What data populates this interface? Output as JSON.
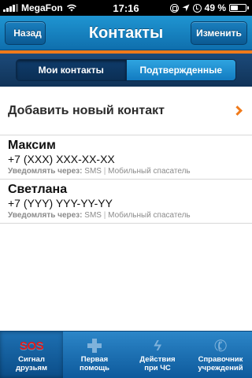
{
  "status_bar": {
    "carrier": "MegaFon",
    "time": "17:16",
    "battery_percent": "49 %",
    "battery_level": 0.49,
    "icons": [
      "signal-icon",
      "wifi-icon",
      "rotation-lock-icon",
      "location-icon",
      "alarm-icon",
      "battery-icon"
    ]
  },
  "nav": {
    "back_label": "Назад",
    "title": "Контакты",
    "edit_label": "Изменить"
  },
  "segments": [
    {
      "label": "Мои контакты",
      "active": false
    },
    {
      "label": "Подтвержденные",
      "active": true
    }
  ],
  "add_contact": {
    "label": "Добавить новый контакт",
    "icon": "chevron-right-icon"
  },
  "contacts": [
    {
      "name": "Максим",
      "phone": "+7 (XXX) XXX-XX-XX",
      "notify_label": "Уведомлять через:",
      "channel_1": "SMS",
      "separator": "|",
      "channel_2": "Мобильный спасатель"
    },
    {
      "name": "Светлана",
      "phone": "+7 (YYY) YYY-YY-YY",
      "notify_label": "Уведомлять через:",
      "channel_1": "SMS",
      "separator": "|",
      "channel_2": "Мобильный спасатель"
    }
  ],
  "tabs": [
    {
      "label": "Сигнал\nдрузьям",
      "icon": "sos-icon",
      "icon_text": "SOS",
      "active": true
    },
    {
      "label": "Первая\nпомощь",
      "icon": "first-aid-cross-icon",
      "active": false
    },
    {
      "label": "Действия\nпри ЧС",
      "icon": "lightning-bolt-icon",
      "active": false
    },
    {
      "label": "Справочник\nучреждений",
      "icon": "phone-handset-icon",
      "active": false
    }
  ],
  "colors": {
    "nav_blue": "#1482c2",
    "accent_orange": "#f07a1a",
    "segment_dark": "#103358",
    "sos_red": "#e01b1b"
  }
}
